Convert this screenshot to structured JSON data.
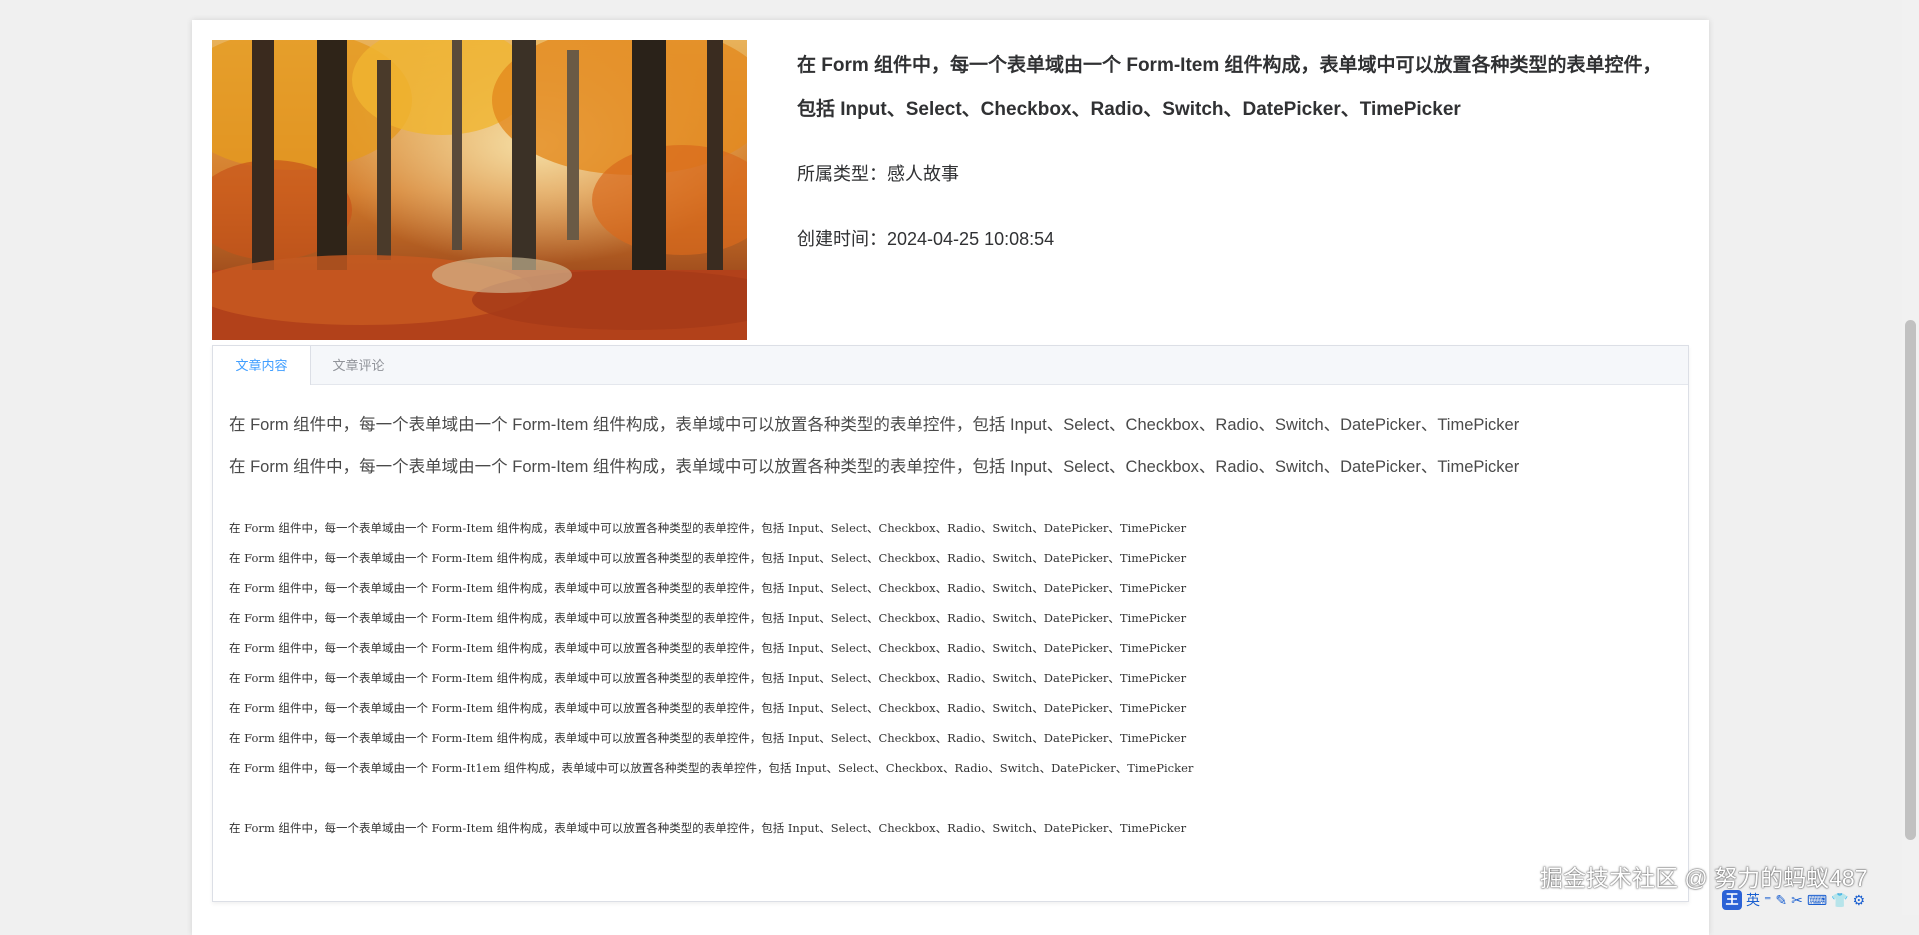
{
  "article": {
    "title": "在 Form 组件中，每一个表单域由一个 Form-Item 组件构成，表单域中可以放置各种类型的表单控件，包括 Input、Select、Checkbox、Radio、Switch、DatePicker、TimePicker",
    "type_label": "所属类型：",
    "type_value": "感人故事",
    "time_label": "创建时间：",
    "time_value": "2024-04-25 10:08:54"
  },
  "tabs": [
    {
      "label": "文章内容",
      "active": true
    },
    {
      "label": "文章评论",
      "active": false
    }
  ],
  "content": {
    "large_paragraphs": [
      "在 Form 组件中，每一个表单域由一个 Form-Item 组件构成，表单域中可以放置各种类型的表单控件，包括 Input、Select、Checkbox、Radio、Switch、DatePicker、TimePicker",
      "在 Form 组件中，每一个表单域由一个 Form-Item 组件构成，表单域中可以放置各种类型的表单控件，包括 Input、Select、Checkbox、Radio、Switch、DatePicker、TimePicker"
    ],
    "small_paragraphs": [
      "在 Form 组件中，每一个表单域由一个 Form-Item 组件构成，表单域中可以放置各种类型的表单控件，包括 Input、Select、Checkbox、Radio、Switch、DatePicker、TimePicker",
      "在 Form 组件中，每一个表单域由一个 Form-Item 组件构成，表单域中可以放置各种类型的表单控件，包括 Input、Select、Checkbox、Radio、Switch、DatePicker、TimePicker",
      "在 Form 组件中，每一个表单域由一个 Form-Item 组件构成，表单域中可以放置各种类型的表单控件，包括 Input、Select、Checkbox、Radio、Switch、DatePicker、TimePicker",
      "在 Form 组件中，每一个表单域由一个 Form-Item 组件构成，表单域中可以放置各种类型的表单控件，包括 Input、Select、Checkbox、Radio、Switch、DatePicker、TimePicker",
      "在 Form 组件中，每一个表单域由一个 Form-Item 组件构成，表单域中可以放置各种类型的表单控件，包括 Input、Select、Checkbox、Radio、Switch、DatePicker、TimePicker",
      "在 Form 组件中，每一个表单域由一个 Form-Item 组件构成，表单域中可以放置各种类型的表单控件，包括 Input、Select、Checkbox、Radio、Switch、DatePicker、TimePicker",
      "在 Form 组件中，每一个表单域由一个 Form-Item 组件构成，表单域中可以放置各种类型的表单控件，包括 Input、Select、Checkbox、Radio、Switch、DatePicker、TimePicker",
      "在 Form 组件中，每一个表单域由一个 Form-Item 组件构成，表单域中可以放置各种类型的表单控件，包括 Input、Select、Checkbox、Radio、Switch、DatePicker、TimePicker",
      "在 Form 组件中，每一个表单域由一个 Form-It1em 组件构成，表单域中可以放置各种类型的表单控件，包括 Input、Select、Checkbox、Radio、Switch、DatePicker、TimePicker"
    ],
    "last_paragraph": "在 Form 组件中，每一个表单域由一个 Form-Item 组件构成，表单域中可以放置各种类型的表单控件，包括 Input、Select、Checkbox、Radio、Switch、DatePicker、TimePicker"
  },
  "watermark": "掘金技术社区 @ 努力的蚂蚁487",
  "ime": {
    "logo": "王",
    "mode": "英",
    "icons": [
      "pen-icon",
      "scissors-icon",
      "keyboard-icon",
      "shirt-icon",
      "gear-icon"
    ]
  },
  "colors": {
    "tab_active": "#409eff",
    "tab_inactive": "#909399",
    "background": "#f0f0f0"
  }
}
